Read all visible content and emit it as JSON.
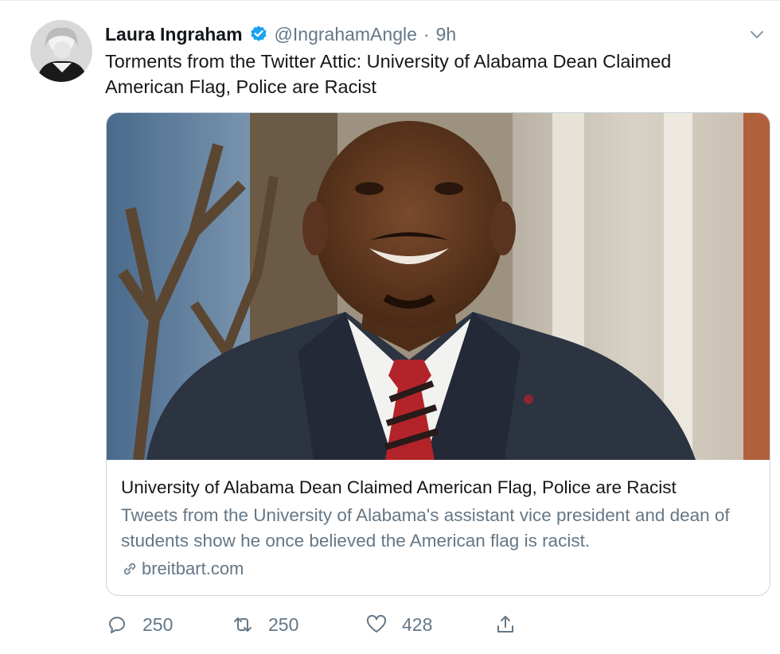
{
  "tweet": {
    "author_name": "Laura Ingraham",
    "handle": "@IngrahamAngle",
    "separator": "·",
    "time": "9h",
    "text": "Torments from the Twitter Attic: University of Alabama Dean Claimed American Flag, Police are Racist",
    "verified_icon": "verified-badge-icon",
    "menu_icon": "chevron-down-icon"
  },
  "card": {
    "title": "University of Alabama Dean Claimed American Flag, Police are Racist",
    "description": "Tweets from the University of Alabama's assistant vice president and dean of students show he once believed the American flag is racist.",
    "domain": "breitbart.com",
    "link_icon": "link-icon"
  },
  "actions": {
    "reply_count": "250",
    "retweet_count": "250",
    "like_count": "428",
    "icons": [
      "reply-icon",
      "retweet-icon",
      "like-icon",
      "share-icon"
    ]
  },
  "colors": {
    "accent": "#1da1f2",
    "muted": "#657786",
    "text": "#14171a",
    "border": "#ccd6dd"
  }
}
